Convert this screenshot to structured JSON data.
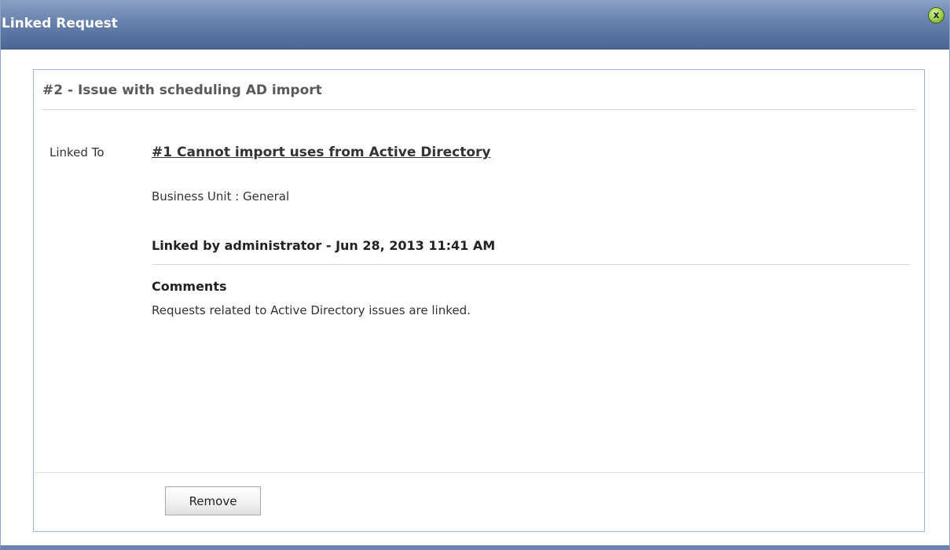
{
  "window": {
    "title": "Linked Request",
    "close_icon_glyph": "x"
  },
  "request": {
    "header": "#2 - Issue with scheduling AD import"
  },
  "link": {
    "label": "Linked To",
    "linked_request_title": "#1 Cannot import uses from Active Directory",
    "business_unit": "Business Unit : General",
    "linked_by": "Linked by administrator - Jun 28, 2013 11:41 AM",
    "comments_heading": "Comments",
    "comments_text": "Requests related to Active Directory issues are linked."
  },
  "actions": {
    "remove_label": "Remove"
  },
  "colors": {
    "titlebar": "#6881ac",
    "panel_border": "#9db6d9",
    "close_icon": "#9ccc4c"
  }
}
